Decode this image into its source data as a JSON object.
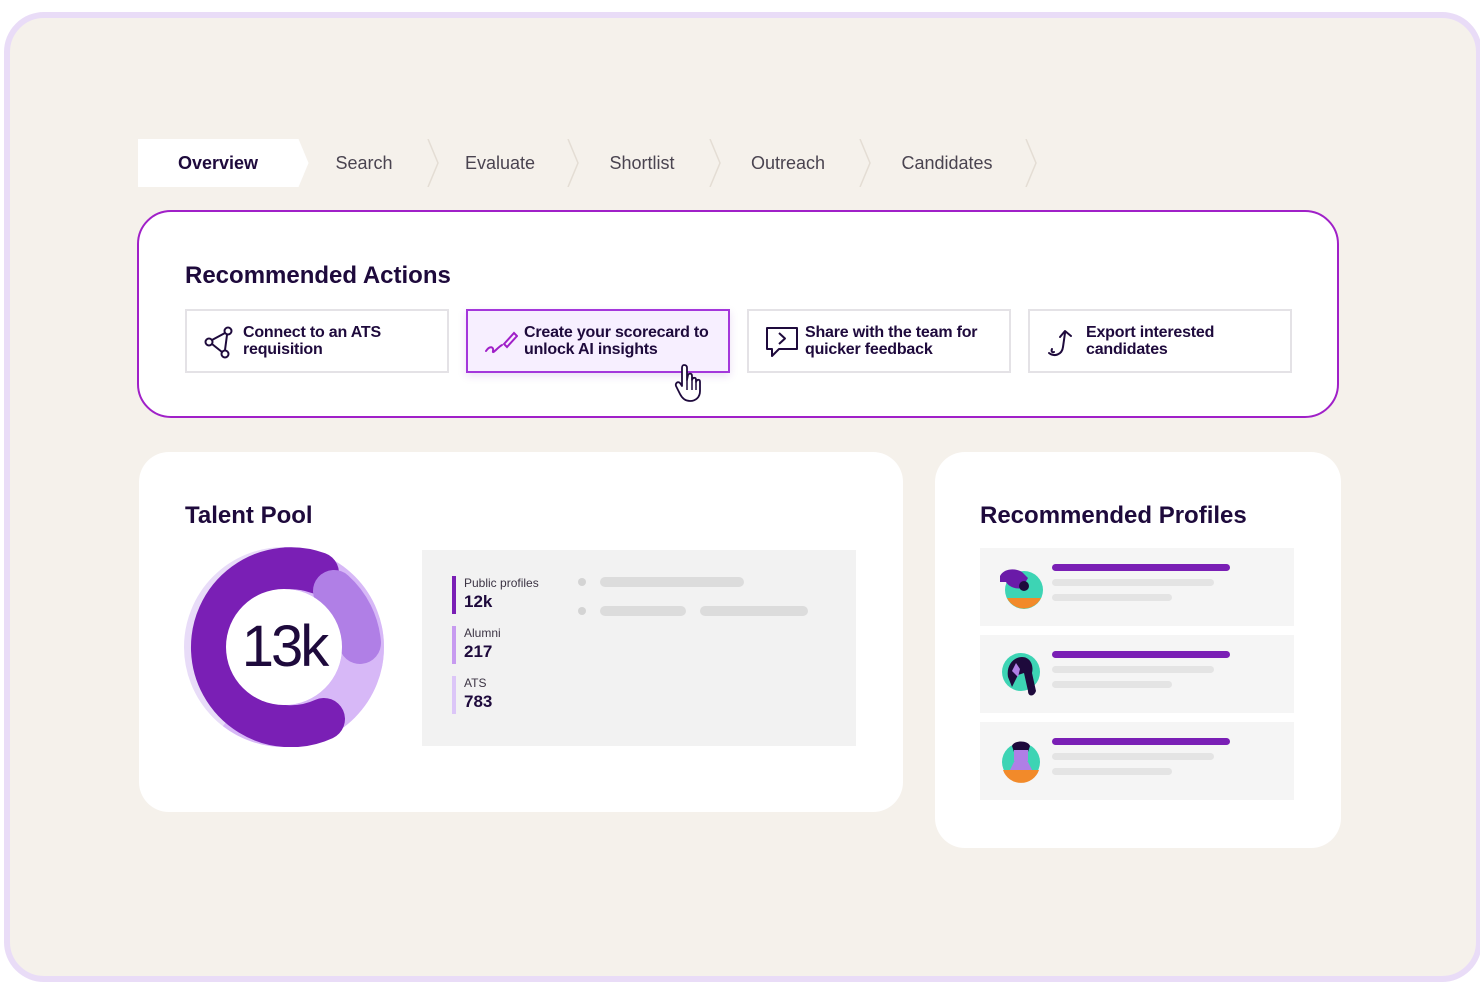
{
  "tabs": [
    {
      "label": "Overview",
      "active": true
    },
    {
      "label": "Search",
      "active": false
    },
    {
      "label": "Evaluate",
      "active": false
    },
    {
      "label": "Shortlist",
      "active": false
    },
    {
      "label": "Outreach",
      "active": false
    },
    {
      "label": "Candidates",
      "active": false
    }
  ],
  "recommended_actions": {
    "title": "Recommended Actions",
    "items": [
      {
        "label": "Connect to an ATS requisition",
        "icon": "network-nodes-icon",
        "selected": false
      },
      {
        "label": "Create your scorecard to unlock AI insights",
        "icon": "pen-signature-icon",
        "selected": true
      },
      {
        "label": "Share with the team for quicker feedback",
        "icon": "chat-share-icon",
        "selected": false
      },
      {
        "label": "Export interested candidates",
        "icon": "export-arrow-icon",
        "selected": false
      }
    ]
  },
  "talent_pool": {
    "title": "Talent Pool",
    "total": "13k",
    "stats": [
      {
        "name": "Public profiles",
        "value": "12k",
        "color": "#7a1fb5"
      },
      {
        "name": "Alumni",
        "value": "217",
        "color": "#c79bf0"
      },
      {
        "name": "ATS",
        "value": "783",
        "color": "#dcc6f8"
      }
    ]
  },
  "recommended_profiles": {
    "title": "Recommended Profiles",
    "profiles": [
      {
        "avatar": "avatar-person-1"
      },
      {
        "avatar": "avatar-person-2"
      },
      {
        "avatar": "avatar-person-3"
      }
    ]
  },
  "colors": {
    "accent": "#a020c8",
    "primary_purple": "#7a1fb5",
    "background": "#f5f1eb"
  }
}
